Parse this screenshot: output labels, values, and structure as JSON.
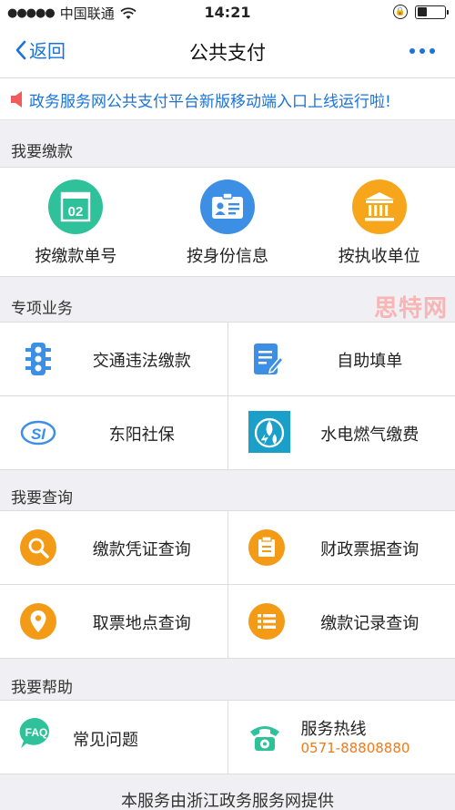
{
  "status": {
    "signal": "●●●●●",
    "carrier": "中国联通",
    "time": "14:21"
  },
  "nav": {
    "back_label": "返回",
    "title": "公共支付"
  },
  "notice": {
    "text": "政务服务网公共支付平台新版移动端入口上线运行啦!"
  },
  "pay": {
    "section_title": "我要缴款",
    "items": [
      {
        "label": "按缴款单号",
        "icon": "receipt-number-icon",
        "color": "#2fc29a",
        "badge": "02"
      },
      {
        "label": "按身份信息",
        "icon": "id-card-icon",
        "color": "#3d8fe6"
      },
      {
        "label": "按执收单位",
        "icon": "bank-building-icon",
        "color": "#f7a61b"
      }
    ]
  },
  "special": {
    "section_title": "专项业务",
    "items": [
      {
        "label": "交通违法缴款",
        "icon": "traffic-light-icon"
      },
      {
        "label": "自助填单",
        "icon": "form-edit-icon"
      },
      {
        "label": "东阳社保",
        "icon": "social-security-icon",
        "badge": "SI"
      },
      {
        "label": "水电燃气缴费",
        "icon": "utilities-icon"
      }
    ]
  },
  "query": {
    "section_title": "我要查询",
    "items": [
      {
        "label": "缴款凭证查询",
        "icon": "search-icon"
      },
      {
        "label": "财政票据查询",
        "icon": "bill-icon"
      },
      {
        "label": "取票地点查询",
        "icon": "location-pin-icon"
      },
      {
        "label": "缴款记录查询",
        "icon": "list-icon"
      }
    ]
  },
  "help": {
    "section_title": "我要帮助",
    "faq_badge": "FAQ",
    "faq_label": "常见问题",
    "hotline_label": "服务热线",
    "hotline_number": "0571-88808880"
  },
  "watermark": "思特网",
  "footer": "本服务由浙江政务服务网提供",
  "colors": {
    "accent": "#1a73d9",
    "orange": "#f39a17",
    "hotline": "#f07a1c"
  }
}
